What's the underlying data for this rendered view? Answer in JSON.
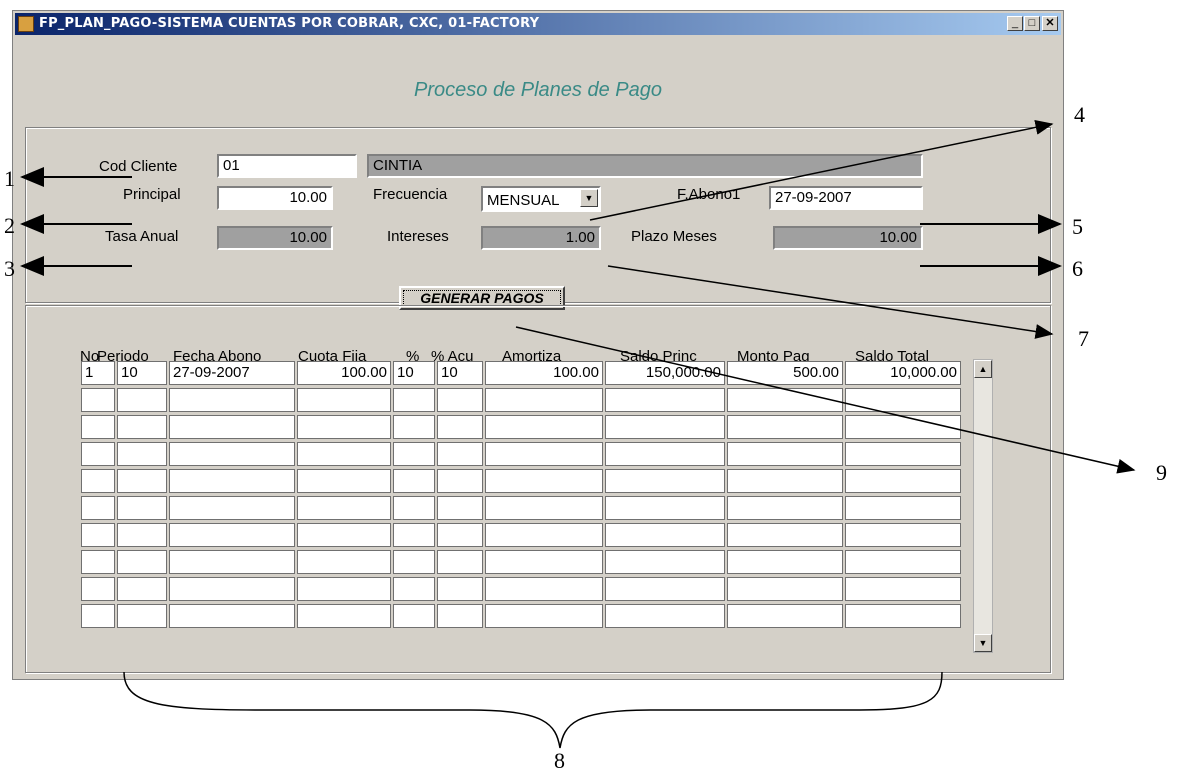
{
  "window": {
    "title": "FP_PLAN_PAGO-SISTEMA CUENTAS POR COBRAR, CXC, 01-FACTORY"
  },
  "form_title": "Proceso de Planes de Pago",
  "fields": {
    "cod_cliente": {
      "label": "Cod Cliente",
      "value": "01"
    },
    "cliente_nombre": {
      "value": "CINTIA"
    },
    "principal": {
      "label": "Principal",
      "value": "10.00"
    },
    "frecuencia": {
      "label": "Frecuencia",
      "value": "MENSUAL"
    },
    "f_abono1": {
      "label": "F.Abono1",
      "value": "27-09-2007"
    },
    "tasa_anual": {
      "label": "Tasa Anual",
      "value": "10.00"
    },
    "intereses": {
      "label": "Intereses",
      "value": "1.00"
    },
    "plazo_meses": {
      "label": "Plazo Meses",
      "value": "10.00"
    }
  },
  "generate_button": {
    "label": "GENERAR PAGOS"
  },
  "table": {
    "headers": [
      "No",
      "Periodo",
      "Fecha Abono",
      "Cuota Fija",
      "%",
      "% Acu",
      "Amortiza",
      "Saldo Princ",
      "Monto Pag",
      "Saldo Total"
    ],
    "rows": [
      [
        "1",
        "10",
        "27-09-2007",
        "100.00",
        "10",
        "10",
        "100.00",
        "150,000.00",
        "500.00",
        "10,000.00"
      ],
      [
        "",
        "",
        "",
        "",
        "",
        "",
        "",
        "",
        "",
        ""
      ],
      [
        "",
        "",
        "",
        "",
        "",
        "",
        "",
        "",
        "",
        ""
      ],
      [
        "",
        "",
        "",
        "",
        "",
        "",
        "",
        "",
        "",
        ""
      ],
      [
        "",
        "",
        "",
        "",
        "",
        "",
        "",
        "",
        "",
        ""
      ],
      [
        "",
        "",
        "",
        "",
        "",
        "",
        "",
        "",
        "",
        ""
      ],
      [
        "",
        "",
        "",
        "",
        "",
        "",
        "",
        "",
        "",
        ""
      ],
      [
        "",
        "",
        "",
        "",
        "",
        "",
        "",
        "",
        "",
        ""
      ],
      [
        "",
        "",
        "",
        "",
        "",
        "",
        "",
        "",
        "",
        ""
      ],
      [
        "",
        "",
        "",
        "",
        "",
        "",
        "",
        "",
        "",
        ""
      ]
    ]
  },
  "callouts": [
    "1",
    "2",
    "3",
    "4",
    "5",
    "6",
    "7",
    "8",
    "9"
  ]
}
